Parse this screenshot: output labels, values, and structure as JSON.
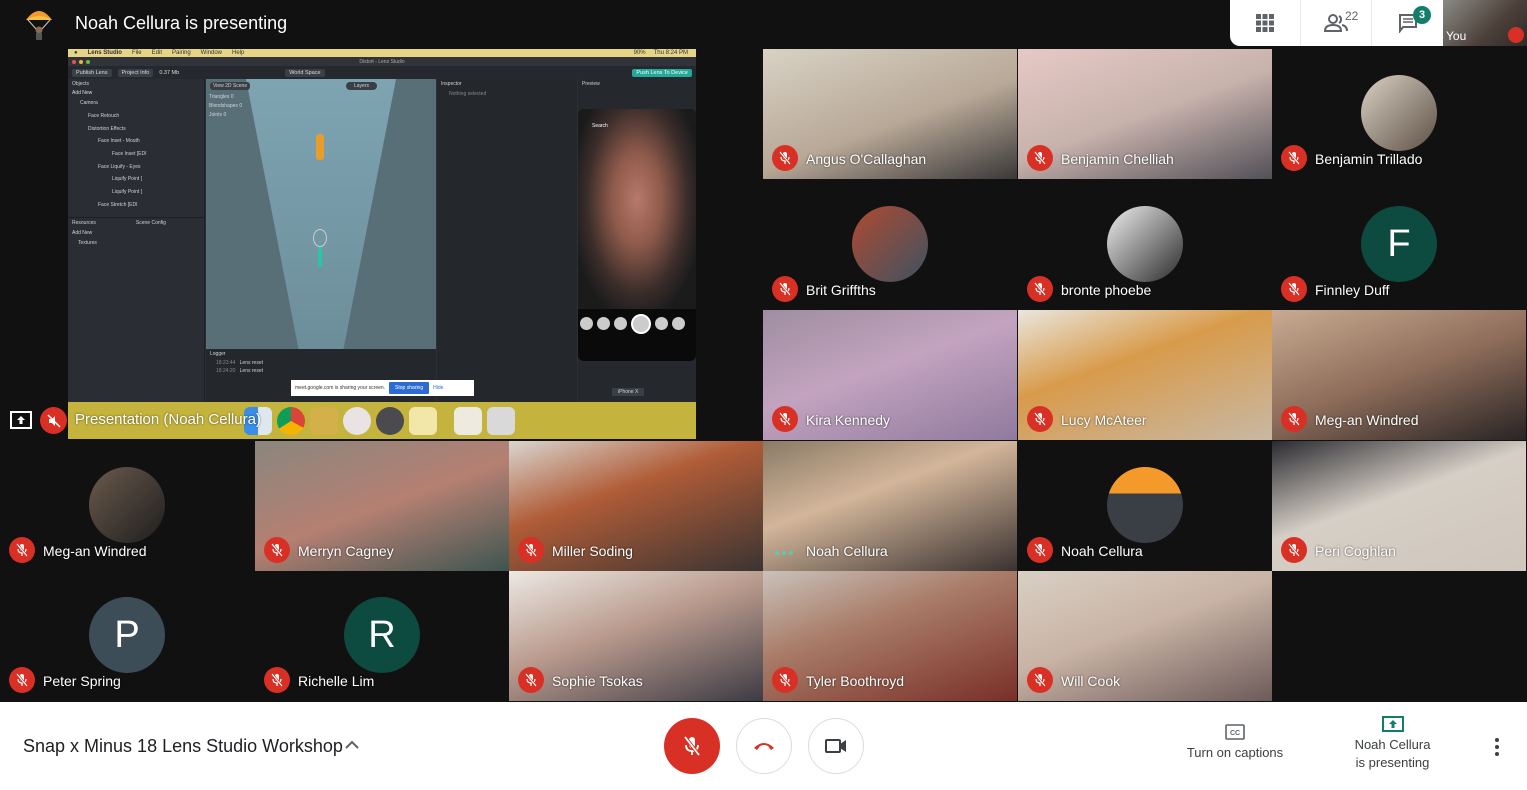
{
  "header": {
    "presenter_title": "Noah Cellura is presenting",
    "participants_count": "22",
    "chat_badge_count": "3",
    "self_view_label": "You"
  },
  "icons": {
    "grid": "grid-layout-icon",
    "people": "people-icon",
    "chat": "chat-icon",
    "mic_off": "mic-off-icon",
    "hangup": "hangup-icon",
    "camera": "camera-icon",
    "captions": "cc-icon",
    "present": "present-screen-icon",
    "more": "more-vert-icon"
  },
  "colors": {
    "mute_red": "#d93025",
    "teal": "#137d6b",
    "background": "#111111"
  },
  "presentation": {
    "label": "Presentation (Noah Cellura)",
    "screen": {
      "menubar": {
        "app": "Lens Studio",
        "items": [
          "File",
          "Edit",
          "Pairing",
          "Window",
          "Help"
        ],
        "battery": "90%",
        "clock": "Thu 8:24 PM"
      },
      "window_title": "Distort - Lens Studio",
      "toolbar": {
        "publish": "Publish Lens",
        "project_info": "Project Info",
        "size": "0.37 Mb",
        "world_space": "World Space",
        "push": "Push Lens To Device"
      },
      "objects_panel": {
        "title": "Objects",
        "add_new": "Add New",
        "tree": [
          "Camera",
          "Face Retouch",
          "Distortion Effects",
          "Face Inset - Mouth",
          "Face Inset [EDI",
          "Face Liquify - Eyes",
          "Liquify Point [",
          "Liquify Point [",
          "Face Stretch [EDI"
        ]
      },
      "resources_panel": {
        "tab1": "Resources",
        "tab2": "Scene Config",
        "add_new": "Add New",
        "folder": "Textures"
      },
      "scene_panel": {
        "view_button": "View 2D Scene",
        "layers": "Layers",
        "stats": [
          {
            "label": "Triangles",
            "v1": "0",
            "v2": "0"
          },
          {
            "label": "Blendshapes",
            "v1": "0",
            "v2": "0"
          },
          {
            "label": "Joints",
            "v1": "0",
            "v2": "0"
          }
        ]
      },
      "inspector": {
        "title": "Inspector",
        "empty": "Nothing selected"
      },
      "preview": {
        "title": "Preview",
        "search": "Search",
        "device": "iPhone X"
      },
      "logger": {
        "title": "Logger",
        "entries": [
          {
            "time": "18:23:44",
            "msg": "Lens reset"
          },
          {
            "time": "18:24:20",
            "msg": "Lens reset"
          }
        ]
      },
      "share_notice": {
        "text": "meet.google.com is sharing your screen.",
        "stop": "Stop sharing",
        "hide": "Hide"
      }
    }
  },
  "participants": [
    {
      "name": "Angus O'Callaghan",
      "type": "video",
      "muted": true
    },
    {
      "name": "Benjamin Chelliah",
      "type": "video",
      "muted": true
    },
    {
      "name": "Benjamin Trillado",
      "type": "photo",
      "muted": true
    },
    {
      "name": "Brit Griffths",
      "type": "photo",
      "muted": true
    },
    {
      "name": "bronte phoebe",
      "type": "photo",
      "muted": true
    },
    {
      "name": "Finnley Duff",
      "type": "initial",
      "initial": "F",
      "color": "#0d4a3f",
      "muted": true
    },
    {
      "name": "Kira Kennedy",
      "type": "video",
      "muted": true
    },
    {
      "name": "Lucy McAteer",
      "type": "video",
      "muted": true
    },
    {
      "name": "Meg-an Windred",
      "type": "video",
      "muted": true
    },
    {
      "name": "Meg-an Windred",
      "type": "photo",
      "muted": true
    },
    {
      "name": "Merryn Cagney",
      "type": "video",
      "muted": true
    },
    {
      "name": "Miller Soding",
      "type": "video",
      "muted": true
    },
    {
      "name": "Noah Cellura",
      "type": "video",
      "muted": false,
      "speaking": true
    },
    {
      "name": "Noah Cellura",
      "type": "photo",
      "muted": true
    },
    {
      "name": "Peri Coghlan",
      "type": "video",
      "muted": true
    },
    {
      "name": "Peter Spring",
      "type": "initial",
      "initial": "P",
      "color": "#3c4d57",
      "muted": true
    },
    {
      "name": "Richelle Lim",
      "type": "initial",
      "initial": "R",
      "color": "#0d4a3f",
      "muted": true
    },
    {
      "name": "Sophie Tsokas",
      "type": "video",
      "muted": true
    },
    {
      "name": "Tyler Boothroyd",
      "type": "video",
      "muted": true
    },
    {
      "name": "Will Cook",
      "type": "video",
      "muted": true
    }
  ],
  "footer": {
    "meeting_title": "Snap x Minus 18 Lens Studio Workshop",
    "captions_label": "Turn on captions",
    "presenting_line1": "Noah Cellura",
    "presenting_line2": "is presenting"
  }
}
